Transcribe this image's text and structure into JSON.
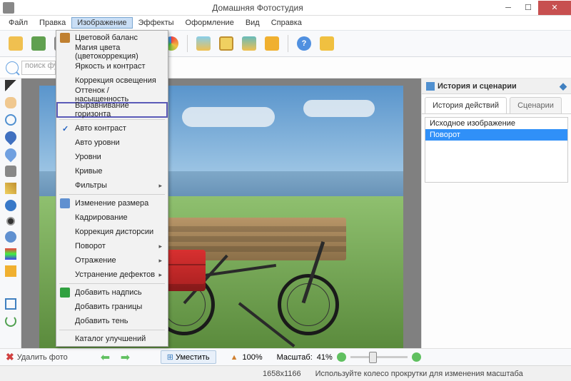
{
  "title": "Домашняя Фотостудия",
  "menus": [
    "Файл",
    "Правка",
    "Изображение",
    "Эффекты",
    "Оформление",
    "Вид",
    "Справка"
  ],
  "search_placeholder": "поиск фу",
  "dropdown": {
    "items": [
      {
        "label": "Цветовой баланс",
        "icon": "#c08030"
      },
      {
        "label": "Магия цвета (цветокоррекция)"
      },
      {
        "label": "Яркость и контраст"
      },
      {
        "label": "Коррекция освещения"
      },
      {
        "label": "Оттенок / насыщенность"
      },
      {
        "label": "Выравнивание горизонта",
        "highlight": true
      },
      {
        "sep": true
      },
      {
        "label": "Авто контраст",
        "check": true
      },
      {
        "label": "Авто уровни"
      },
      {
        "label": "Уровни"
      },
      {
        "label": "Кривые"
      },
      {
        "label": "Фильтры",
        "arrow": true
      },
      {
        "sep": true
      },
      {
        "label": "Изменение размера",
        "icon": "#6090d0"
      },
      {
        "label": "Кадрирование"
      },
      {
        "label": "Коррекция дисторсии"
      },
      {
        "label": "Поворот",
        "arrow": true
      },
      {
        "label": "Отражение",
        "arrow": true
      },
      {
        "label": "Устранение дефектов",
        "arrow": true
      },
      {
        "sep": true
      },
      {
        "label": "Добавить надпись",
        "icon": "#30a040"
      },
      {
        "label": "Добавить границы"
      },
      {
        "label": "Добавить тень"
      },
      {
        "sep": true
      },
      {
        "label": "Каталог улучшений"
      }
    ]
  },
  "right_panel": {
    "title": "История и сценарии",
    "tabs": [
      "История действий",
      "Сценарии"
    ],
    "history": [
      "Исходное изображение",
      "Поворот"
    ]
  },
  "status": {
    "delete": "Удалить фото",
    "fit": "Уместить",
    "hundred": "100%",
    "scale_label": "Масштаб:",
    "scale_value": "41%"
  },
  "footer": {
    "dimensions": "1658x1166",
    "hint": "Используйте колесо прокрутки для изменения масштаба"
  }
}
